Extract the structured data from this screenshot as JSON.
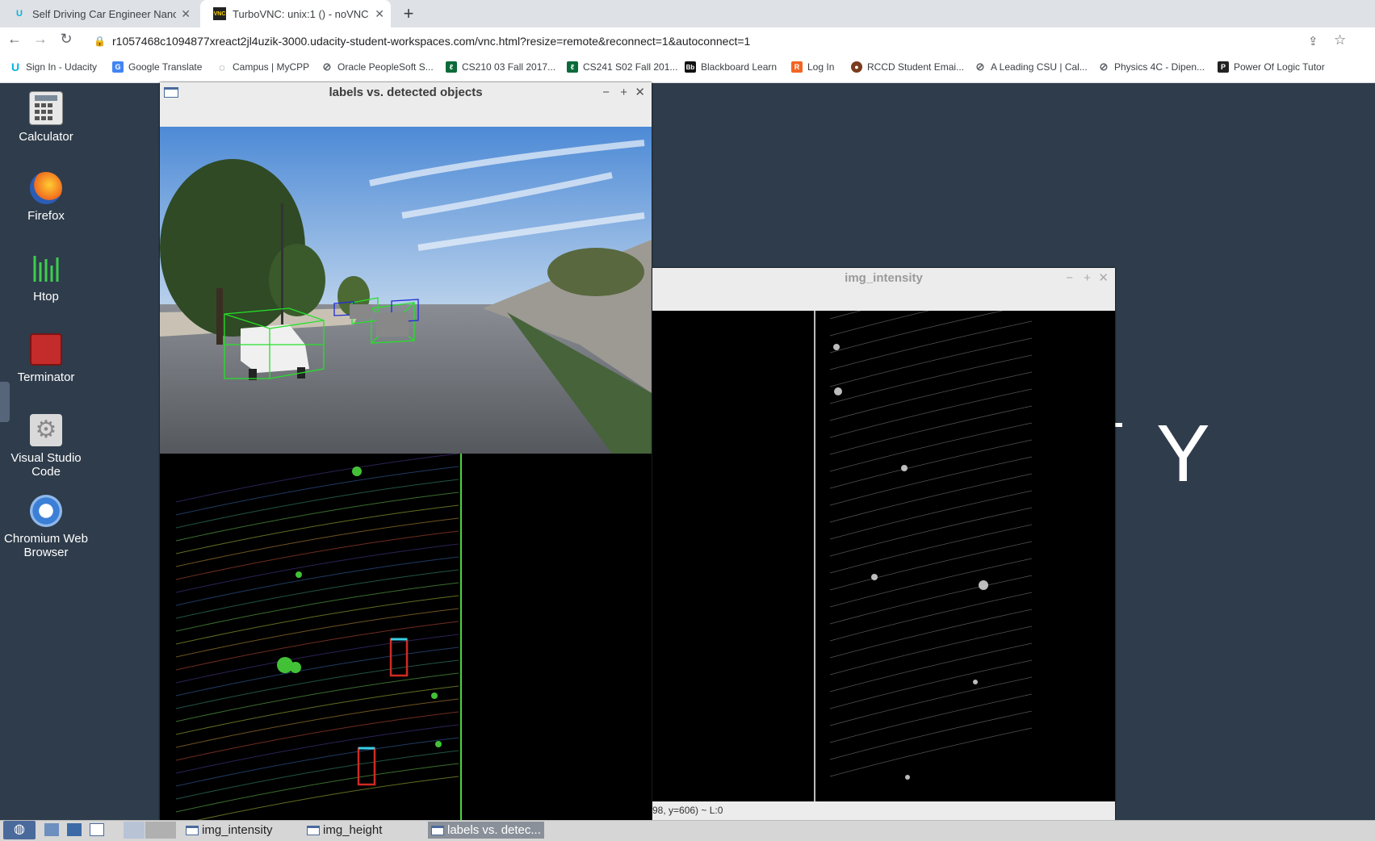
{
  "browser": {
    "tabs": [
      {
        "label": "Self Driving Car Engineer Nanode",
        "icon": "udacity-icon",
        "active": false
      },
      {
        "label": "TurboVNC: unix:1 () - noVNC",
        "icon": "vnc-icon",
        "active": true
      }
    ],
    "url": "r1057468c1094877xreact2jl4uzik-3000.udacity-student-workspaces.com/vnc.html?resize=remote&reconnect=1&autoconnect=1",
    "bookmarks": [
      {
        "label": "Sign In - Udacity",
        "icon": "udacity-icon"
      },
      {
        "label": "Google Translate",
        "icon": "translate-icon"
      },
      {
        "label": "Campus | MyCPP",
        "icon": "globe-icon"
      },
      {
        "label": "Oracle PeopleSoft S...",
        "icon": "globe-icon"
      },
      {
        "label": "CS210 03 Fall 2017...",
        "icon": "leaf-icon"
      },
      {
        "label": "CS241 S02 Fall 201...",
        "icon": "leaf-icon"
      },
      {
        "label": "Blackboard Learn",
        "icon": "blackboard-icon"
      },
      {
        "label": "Log In",
        "icon": "r-icon"
      },
      {
        "label": "RCCD Student Emai...",
        "icon": "rccd-icon"
      },
      {
        "label": "A Leading CSU | Cal...",
        "icon": "globe-icon"
      },
      {
        "label": "Physics 4C - Dipen...",
        "icon": "globe-icon"
      },
      {
        "label": "Power Of Logic Tutor",
        "icon": "logic-icon"
      }
    ]
  },
  "desktop": {
    "icons": [
      {
        "label": "Calculator",
        "icon": "calculator-icon"
      },
      {
        "label": "Firefox",
        "icon": "firefox-icon"
      },
      {
        "label": "Htop",
        "icon": "htop-icon"
      },
      {
        "label": "Terminator",
        "icon": "terminator-icon"
      },
      {
        "label": "Visual Studio Code",
        "icon": "gear-icon"
      },
      {
        "label": "Chromium Web Browser",
        "icon": "chromium-icon"
      }
    ],
    "bg_text": "Y"
  },
  "windows": {
    "labels": {
      "title": "labels vs. detected objects"
    },
    "intensity": {
      "title": "img_intensity",
      "status": "98, y=606) ~ L:0"
    }
  },
  "taskbar": {
    "items": [
      {
        "label": "img_intensity"
      },
      {
        "label": "img_height"
      },
      {
        "label": "labels vs. detec..."
      }
    ]
  },
  "colors": {
    "desktop_bg": "#2f3c4b",
    "box_green": "#25e02a",
    "box_blue": "#1f2bd8",
    "box_red": "#d02a22",
    "box_cyan": "#36d0e6"
  }
}
